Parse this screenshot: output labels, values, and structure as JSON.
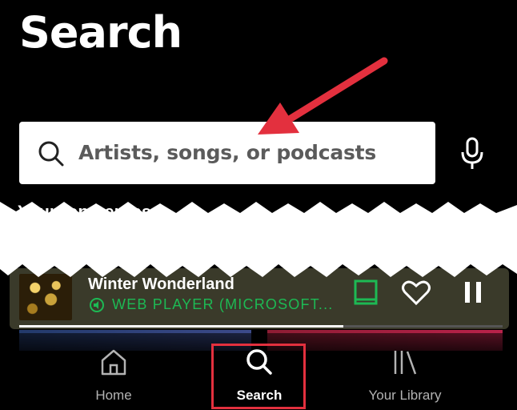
{
  "header": {
    "title": "Search"
  },
  "search": {
    "placeholder": "Artists, songs, or podcasts"
  },
  "section": {
    "title": "Your top genres"
  },
  "now_playing": {
    "track": "Winter Wonderland",
    "device": "WEB PLAYER (MICROSOFT...",
    "progress": 0.67
  },
  "nav": {
    "items": [
      {
        "label": "Home",
        "icon": "home-icon"
      },
      {
        "label": "Search",
        "icon": "search-icon",
        "active": true
      },
      {
        "label": "Your Library",
        "icon": "library-icon"
      }
    ]
  },
  "colors": {
    "background": "#000000",
    "accent_green": "#1db954",
    "annotation_red": "#e3303e"
  }
}
